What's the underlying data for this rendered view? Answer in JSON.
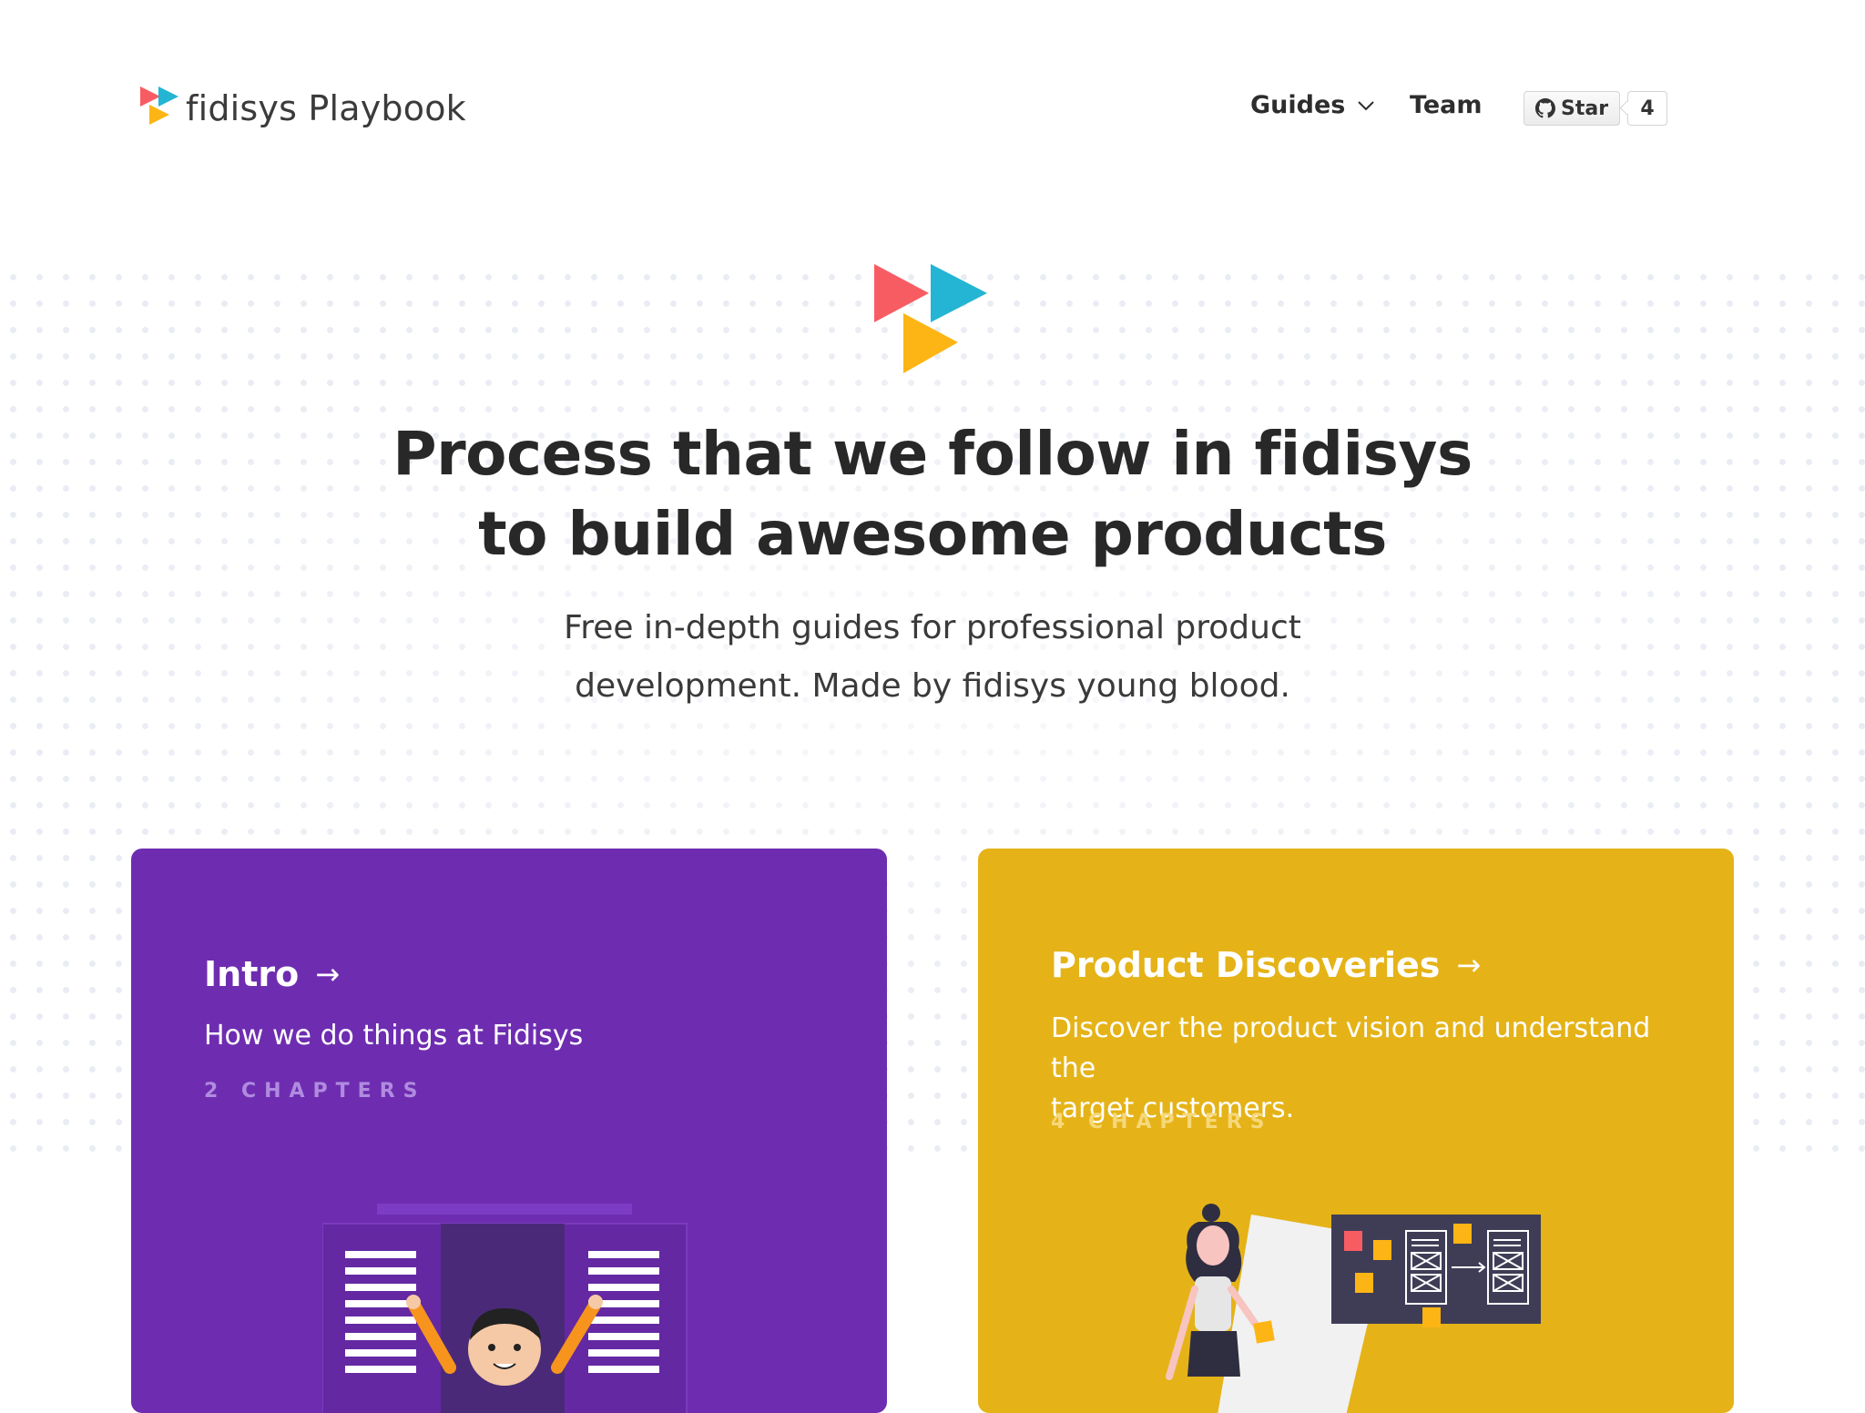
{
  "brand": {
    "name": "fidisys Playbook",
    "logo_icon": "fidisys-triangles-logo"
  },
  "nav": {
    "guides_label": "Guides",
    "team_label": "Team",
    "github": {
      "star_label": "Star",
      "star_count": "4"
    }
  },
  "hero": {
    "title_line1": "Process that we follow in fidisys",
    "title_line2": "to build awesome products",
    "subtitle_line1": "Free in-depth guides for professional product",
    "subtitle_line2": "development. Made by fidisys young blood."
  },
  "guides": [
    {
      "title": "Intro",
      "arrow": "→",
      "description": "How we do things at Fidisys",
      "chapters": "2 CHAPTERS",
      "color": "#6e2db0"
    },
    {
      "title": "Product Discoveries",
      "arrow": "→",
      "description_line1": "Discover the product vision and understand the",
      "description_line2": "target customers.",
      "chapters": "4 CHAPTERS",
      "color": "#e5b318"
    }
  ],
  "colors": {
    "logo_red": "#f85c63",
    "logo_blue": "#23b5d3",
    "logo_yellow": "#fdb515",
    "text_dark": "#282828"
  }
}
